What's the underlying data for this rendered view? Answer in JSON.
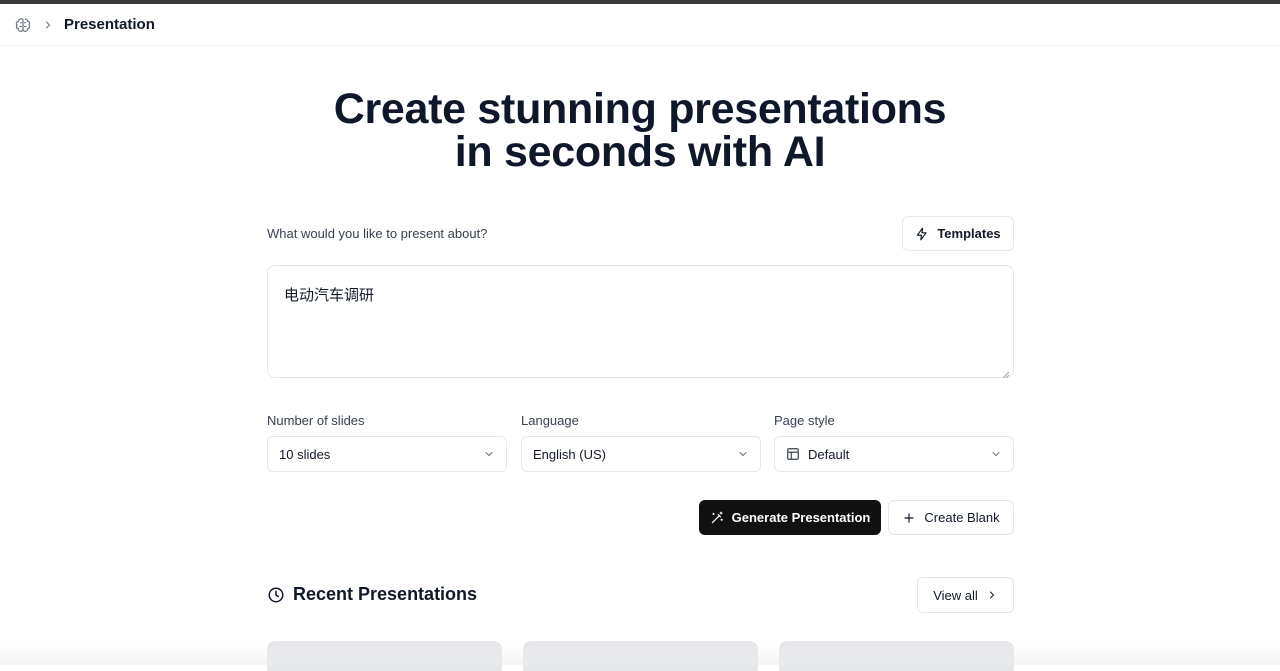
{
  "header": {
    "logo_icon": "brain-icon",
    "separator_icon": "chevron-right-icon",
    "breadcrumb": "Presentation"
  },
  "hero": {
    "line1": "Create stunning presentations",
    "line2": "in seconds with AI"
  },
  "prompt": {
    "label": "What would you like to present about?",
    "value": "电动汽车调研"
  },
  "templates_button": {
    "label": "Templates",
    "icon": "zap-icon"
  },
  "options": {
    "slides": {
      "label": "Number of slides",
      "value": "10 slides"
    },
    "language": {
      "label": "Language",
      "value": "English (US)"
    },
    "page_style": {
      "label": "Page style",
      "value": "Default",
      "icon": "layout-icon"
    }
  },
  "actions": {
    "generate": {
      "label": "Generate Presentation",
      "icon": "magic-wand-icon"
    },
    "blank": {
      "label": "Create Blank",
      "icon": "plus-icon"
    }
  },
  "recent": {
    "title": "Recent Presentations",
    "icon": "clock-icon",
    "view_all": "View all"
  },
  "colors": {
    "primary_button": "#111111",
    "text": "#0f172a",
    "border": "#e5e7eb"
  }
}
